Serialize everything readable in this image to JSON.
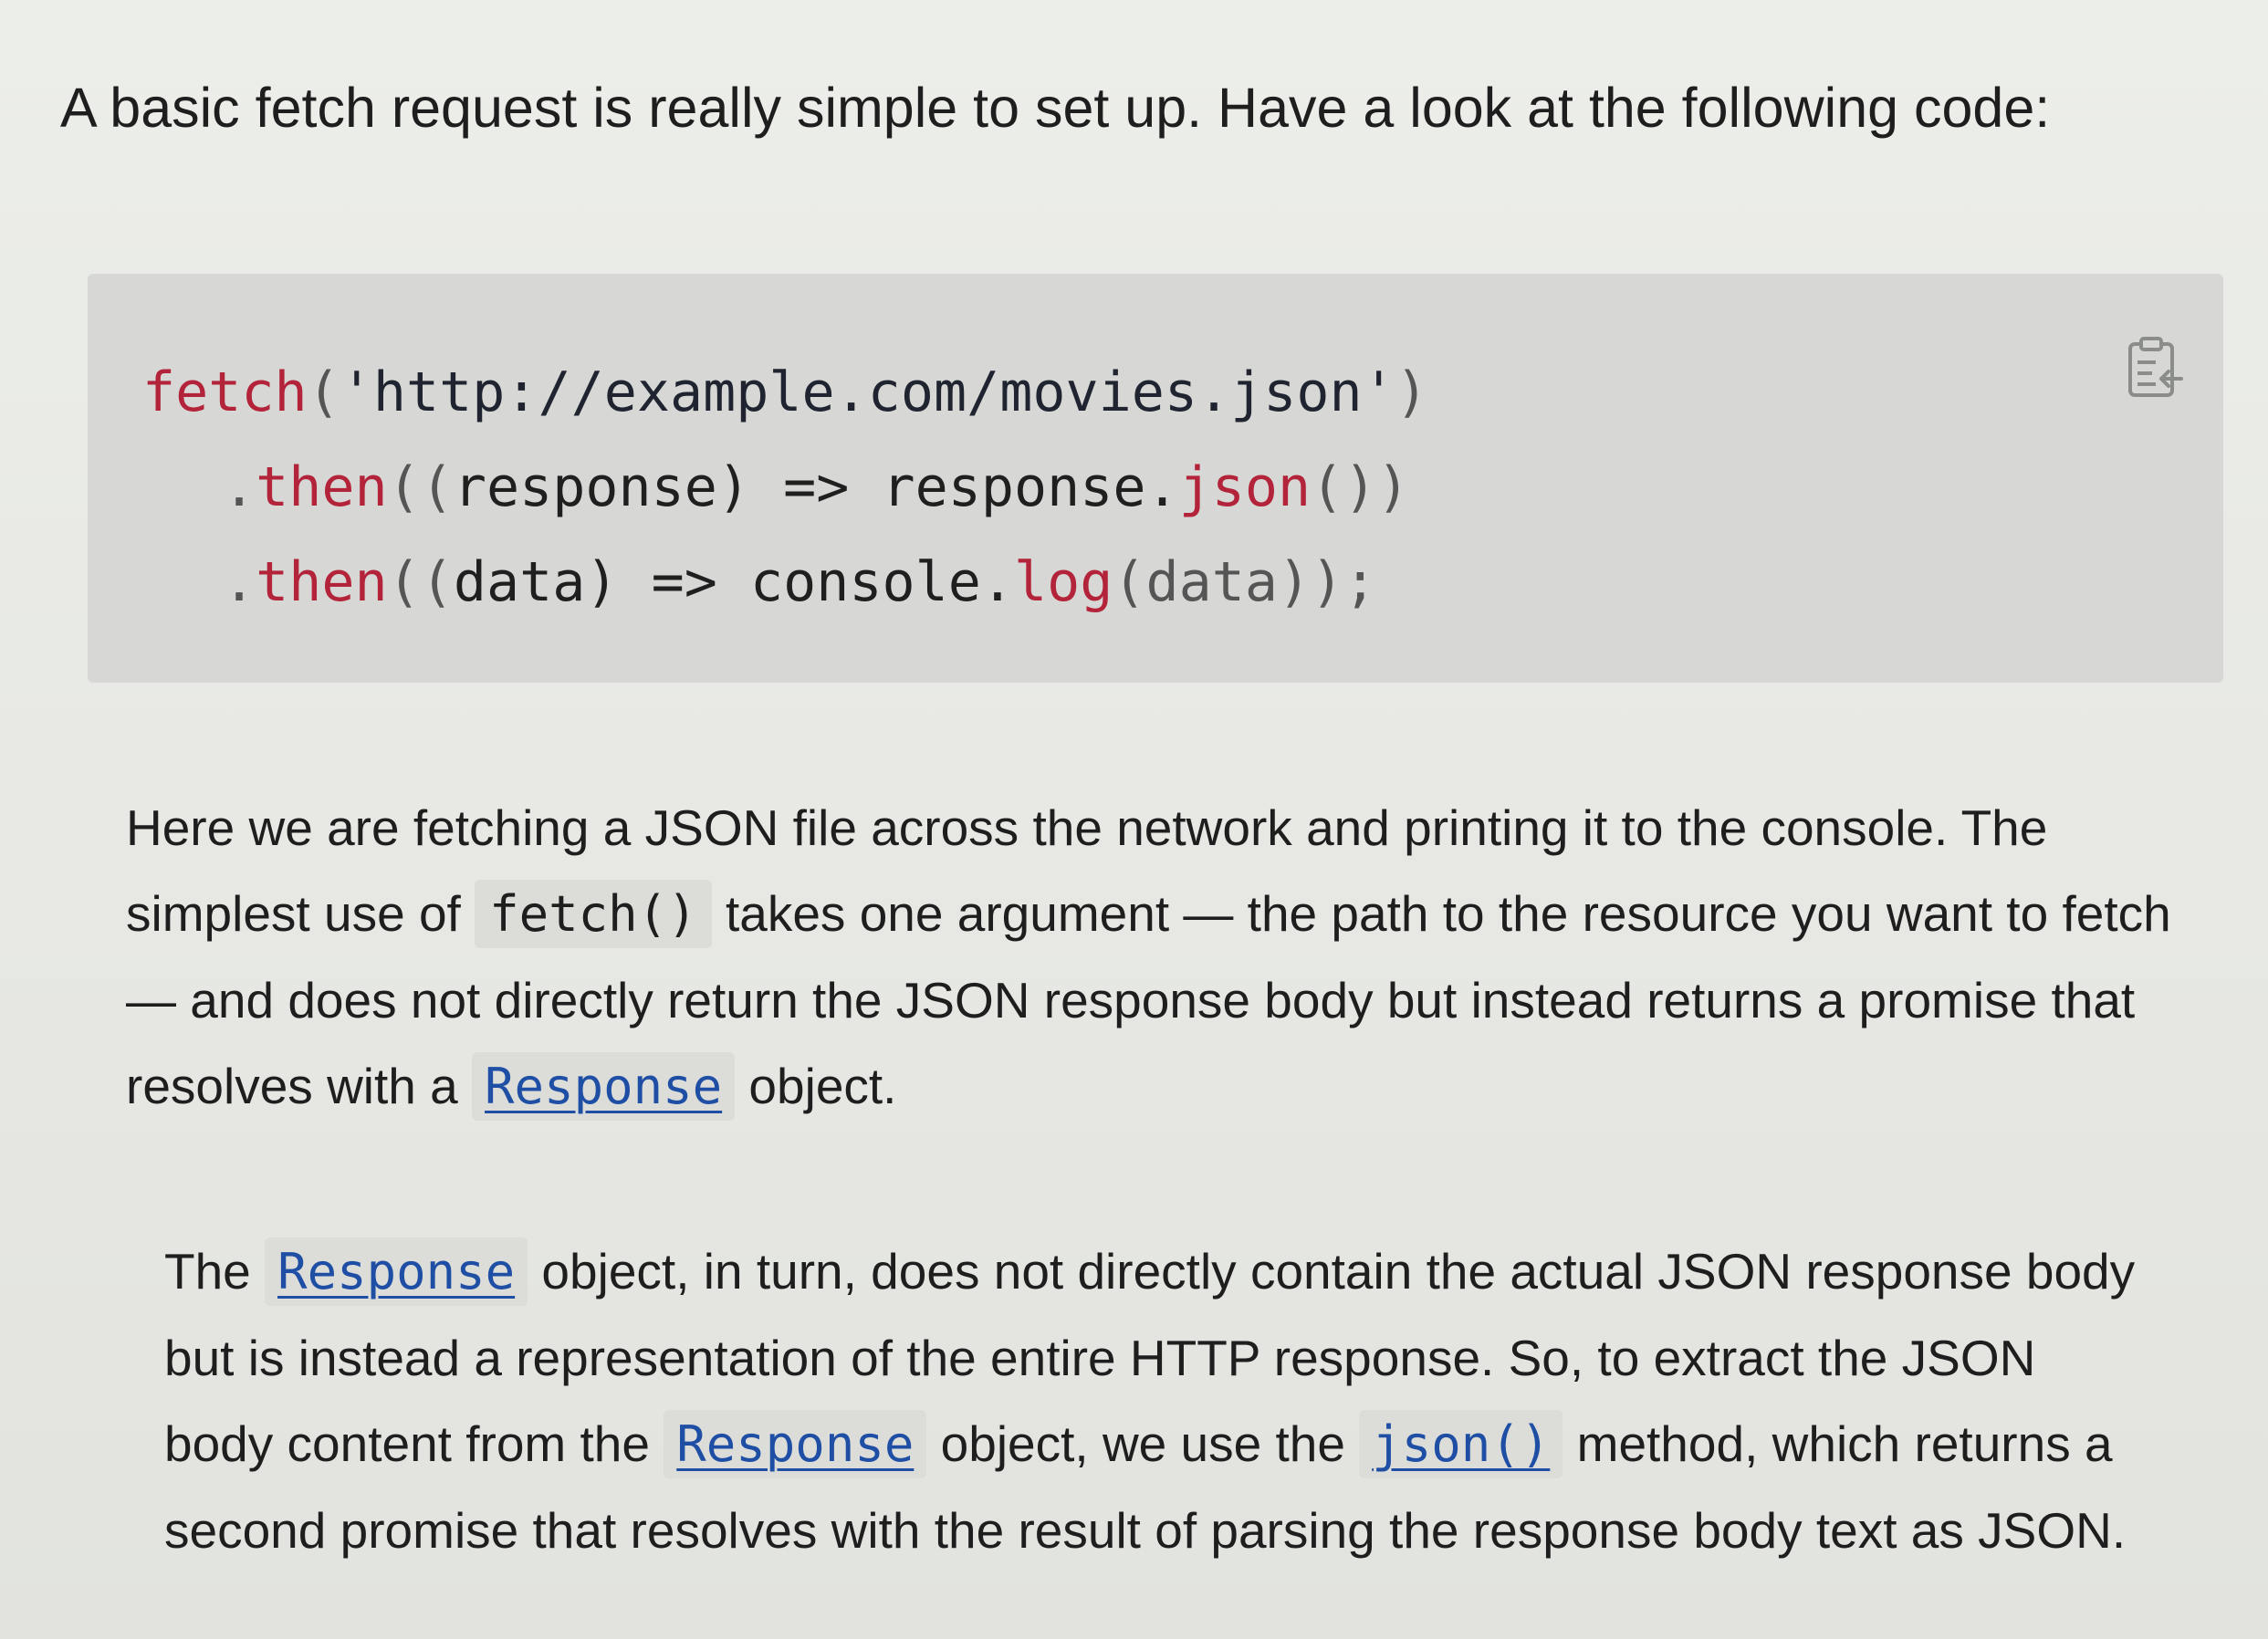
{
  "intro": {
    "text": "A basic fetch request is really simple to set up. Have a look at the following code:"
  },
  "code": {
    "line1": {
      "fn": "fetch",
      "open": "(",
      "str": "'http://example.com/movies.json'",
      "close": ")"
    },
    "line2": {
      "dot": ".",
      "fn": "then",
      "open": "((",
      "arg": "response",
      "arrow": ") => ",
      "obj": "response.",
      "fn2": "json",
      "close": "())"
    },
    "line3": {
      "dot": ".",
      "fn": "then",
      "open": "((",
      "arg": "data",
      "arrow": ") => ",
      "obj": "console.",
      "fn2": "log",
      "close": "(data));"
    },
    "copy_icon": "clipboard-copy-icon"
  },
  "para1": {
    "t1": "Here we are fetching a JSON file across the network and printing it to the console. The simplest use of ",
    "code1": "fetch()",
    "t2": " takes one argument — the path to the resource you want to fetch — and does not directly return the JSON response body but instead returns a promise that resolves with a ",
    "link1": "Response",
    "t3": " object."
  },
  "para2": {
    "t1": "The ",
    "link1": "Response",
    "t2": " object, in turn, does not directly contain the actual JSON response body but is instead a representation of the entire HTTP response. So, to extract the JSON body content from the ",
    "link2": "Response",
    "t3": " object, we use the ",
    "link3": "json()",
    "t4": " method, which returns a second promise that resolves with the result of parsing the response body text as JSON."
  },
  "colors": {
    "function": "#b3233a",
    "link": "#1e4fa5",
    "code_bg": "#d7d8d5"
  }
}
